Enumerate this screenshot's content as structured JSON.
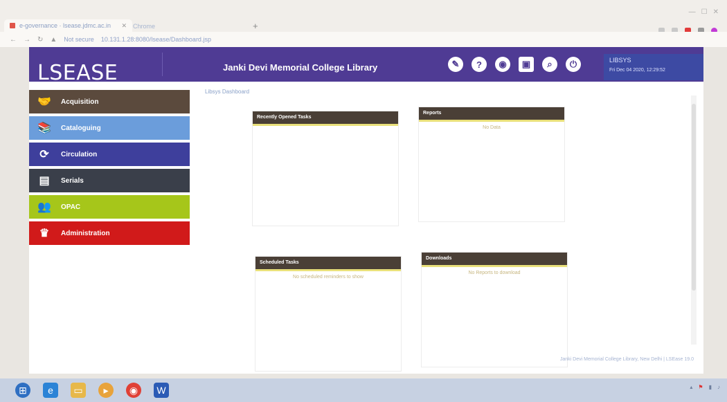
{
  "browser": {
    "tab_title": "e-governance · lsease.jdmc.ac.in",
    "tab2_label": "Chrome",
    "url": "10.131.1.28:8080/lsease/Dashboard.jsp",
    "url_prefix": "Not secure"
  },
  "app": {
    "logo": "LSEASE",
    "title": "Janki Devi Memorial College Library",
    "user": {
      "name": "LIBSYS",
      "datetime": "Fri Dec 04 2020, 12:29:52"
    }
  },
  "sidebar": {
    "items": [
      {
        "label": "Acquisition",
        "icon": "handshake-icon",
        "color": "#5b4a3d"
      },
      {
        "label": "Cataloguing",
        "icon": "books-icon",
        "color": "#6b9ddb"
      },
      {
        "label": "Circulation",
        "icon": "refresh-icon",
        "color": "#3e3f9c"
      },
      {
        "label": "Serials",
        "icon": "stack-icon",
        "color": "#3a3f4a"
      },
      {
        "label": "OPAC",
        "icon": "people-icon",
        "color": "#a6c61a"
      },
      {
        "label": "Administration",
        "icon": "crown-icon",
        "color": "#d11a1a"
      }
    ]
  },
  "main": {
    "breadcrumb": "Libsys Dashboard",
    "panels": {
      "recent": {
        "title": "Recently Opened Tasks",
        "body": ""
      },
      "reports": {
        "title": "Reports",
        "body": "No Data"
      },
      "scheduled": {
        "title": "Scheduled Tasks",
        "body": "No scheduled reminders to show"
      },
      "downloads": {
        "title": "Downloads",
        "body": "No Reports to download"
      }
    },
    "footer": "Janki Devi Memorial College Library, New Delhi | LSEase 19.0"
  },
  "colors": {
    "header_bg": "#4f3b94",
    "panel_header_bg": "#4a3f36",
    "panel_accent": "#e9e07a"
  }
}
